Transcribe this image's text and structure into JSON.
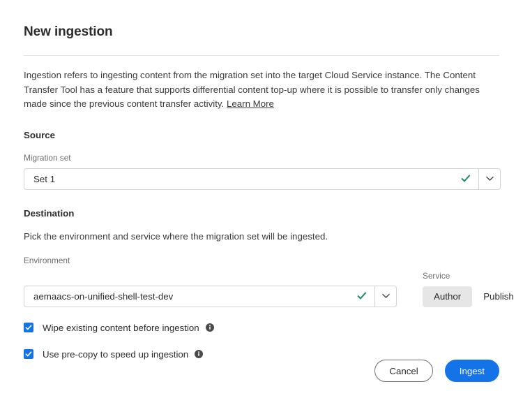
{
  "dialog": {
    "title": "New ingestion",
    "intro_text": "Ingestion refers to ingesting content from the migration set into the target Cloud Service instance. The Content Transfer Tool has a feature that supports differential content top-up where it is possible to transfer only changes made since the previous content transfer activity. ",
    "learn_more_label": "Learn More"
  },
  "source": {
    "heading": "Source",
    "migration_set_label": "Migration set",
    "migration_set_value": "Set 1",
    "valid_icon": "checkmark-icon",
    "dropdown_icon": "chevron-down-icon"
  },
  "destination": {
    "heading": "Destination",
    "description": "Pick the environment and service where the migration set will be ingested.",
    "environment_label": "Environment",
    "environment_value": "aemaacs-on-unified-shell-test-dev",
    "valid_icon": "checkmark-icon",
    "dropdown_icon": "chevron-down-icon",
    "service_label": "Service",
    "service_options": [
      {
        "label": "Author",
        "selected": true
      },
      {
        "label": "Publish",
        "selected": false
      }
    ]
  },
  "options": [
    {
      "label": "Wipe existing content before ingestion",
      "checked": true,
      "info_icon": "info-icon"
    },
    {
      "label": "Use pre-copy to speed up ingestion",
      "checked": true,
      "info_icon": "info-icon"
    }
  ],
  "footer": {
    "cancel_label": "Cancel",
    "ingest_label": "Ingest"
  },
  "colors": {
    "accent_blue": "#1473E6",
    "valid_green": "#268E6C",
    "text_primary": "#2C2C2C",
    "text_secondary": "#6E6E6E",
    "border": "#D3D3D3",
    "divider": "#E4E4E4",
    "segment_selected_bg": "#E6E6E6"
  }
}
